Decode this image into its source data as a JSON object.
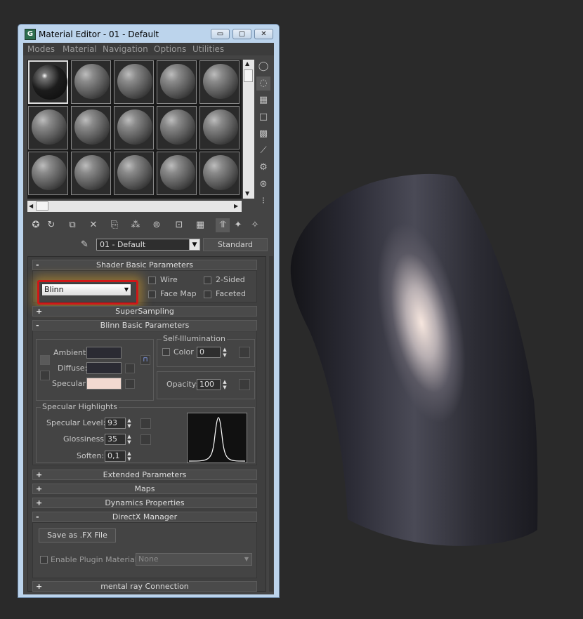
{
  "window": {
    "title": "Material Editor - 01 - Default",
    "app_icon": "G",
    "minimize": "▭",
    "maximize": "▢",
    "close": "✕"
  },
  "menu": [
    "Modes",
    "Material",
    "Navigation",
    "Options",
    "Utilities"
  ],
  "material": {
    "name": "01 - Default",
    "type": "Standard"
  },
  "shader_basic": {
    "title": "Shader Basic Parameters",
    "sign": "-",
    "shader": "Blinn",
    "wire": "Wire",
    "two_sided": "2-Sided",
    "face_map": "Face Map",
    "faceted": "Faceted"
  },
  "supersampling": {
    "title": "SuperSampling",
    "sign": "+"
  },
  "blinn_basic": {
    "title": "Blinn Basic Parameters",
    "sign": "-",
    "ambient": "Ambient:",
    "diffuse": "Diffuse:",
    "specular": "Specular:",
    "ambient_color": "#2b2b33",
    "diffuse_color": "#2b2b33",
    "specular_color": "#f2d9d0",
    "self_illum": {
      "title": "Self-Illumination",
      "color": "Color",
      "value": "0"
    },
    "opacity": {
      "label": "Opacity:",
      "value": "100"
    }
  },
  "specular_highlights": {
    "title": "Specular Highlights",
    "level_label": "Specular Level:",
    "level": "93",
    "gloss_label": "Glossiness:",
    "gloss": "35",
    "soften_label": "Soften:",
    "soften": "0,1"
  },
  "rollouts": [
    {
      "title": "Extended Parameters",
      "sign": "+"
    },
    {
      "title": "Maps",
      "sign": "+"
    },
    {
      "title": "Dynamics Properties",
      "sign": "+"
    }
  ],
  "directx": {
    "title": "DirectX Manager",
    "sign": "-",
    "save_fx": "Save as .FX File",
    "enable_plugin": "Enable Plugin Material",
    "plugin_value": "None"
  },
  "mental_ray": {
    "title": "mental ray Connection",
    "sign": "+"
  },
  "colors": {
    "highlight_border": "#d01818",
    "window_frame": "#bcd4ec",
    "viewport_bg": "#2a2a2a"
  }
}
